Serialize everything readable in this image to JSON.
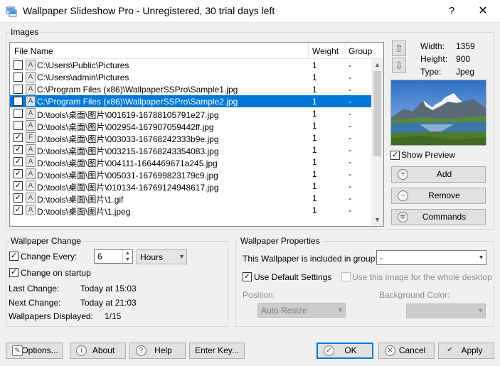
{
  "window": {
    "title": "Wallpaper Slideshow Pro - Unregistered, 30 trial days left",
    "help_glyph": "?",
    "close_glyph": "✕"
  },
  "images": {
    "group_title": "Images",
    "columns": {
      "name": "File Name",
      "weight": "Weight",
      "group": "Group"
    },
    "rows": [
      {
        "checked": false,
        "icon": "A",
        "name": "C:\\Users\\Public\\Pictures",
        "weight": "1",
        "group": "-",
        "selected": false
      },
      {
        "checked": false,
        "icon": "A",
        "name": "C:\\Users\\admin\\Pictures",
        "weight": "1",
        "group": "-",
        "selected": false
      },
      {
        "checked": false,
        "icon": "A",
        "name": "C:\\Program Files (x86)\\WallpaperSSPro\\Sample1.jpg",
        "weight": "1",
        "group": "-",
        "selected": false
      },
      {
        "checked": false,
        "icon": "A",
        "name": "C:\\Program Files (x86)\\WallpaperSSPro\\Sample2.jpg",
        "weight": "1",
        "group": "-",
        "selected": true
      },
      {
        "checked": false,
        "icon": "A",
        "name": "D:\\tools\\桌面\\图片\\001619-16788105791e27.jpg",
        "weight": "1",
        "group": "-",
        "selected": false
      },
      {
        "checked": false,
        "icon": "A",
        "name": "D:\\tools\\桌面\\图片\\002954-167907059442ff.jpg",
        "weight": "1",
        "group": "-",
        "selected": false
      },
      {
        "checked": true,
        "icon": "F",
        "name": "D:\\tools\\桌面\\图片\\003033-16768242333b9e.jpg",
        "weight": "1",
        "group": "-",
        "selected": false
      },
      {
        "checked": true,
        "icon": "A",
        "name": "D:\\tools\\桌面\\图片\\003215-16768243354083.jpg",
        "weight": "1",
        "group": "-",
        "selected": false
      },
      {
        "checked": true,
        "icon": "A",
        "name": "D:\\tools\\桌面\\图片\\004111-1664469671a245.jpg",
        "weight": "1",
        "group": "-",
        "selected": false
      },
      {
        "checked": true,
        "icon": "A",
        "name": "D:\\tools\\桌面\\图片\\005031-167699823179c9.jpg",
        "weight": "1",
        "group": "-",
        "selected": false
      },
      {
        "checked": true,
        "icon": "A",
        "name": "D:\\tools\\桌面\\图片\\010134-16769124948617.jpg",
        "weight": "1",
        "group": "-",
        "selected": false
      },
      {
        "checked": true,
        "icon": "A",
        "name": "D:\\tools\\桌面\\图片\\1.gif",
        "weight": "1",
        "group": "-",
        "selected": false
      },
      {
        "checked": true,
        "icon": "A",
        "name": "D:\\tools\\桌面\\图片\\1.jpeg",
        "weight": "1",
        "group": "-",
        "selected": false
      }
    ],
    "info": {
      "width_label": "Width:",
      "width_value": "1359",
      "height_label": "Height:",
      "height_value": "900",
      "type_label": "Type:",
      "type_value": "Jpeg"
    },
    "show_preview_label": "Show Preview",
    "show_preview_checked": true,
    "add_label": "Add",
    "remove_label": "Remove",
    "commands_label": "Commands"
  },
  "change": {
    "group_title": "Wallpaper Change",
    "change_every_label": "Change Every:",
    "change_every_checked": true,
    "interval_value": "6",
    "interval_unit": "Hours",
    "change_on_startup_label": "Change on startup",
    "change_on_startup_checked": true,
    "last_change_label": "Last Change:",
    "last_change_value": "Today at 15:03",
    "next_change_label": "Next Change:",
    "next_change_value": "Today at 21:03",
    "displayed_label": "Wallpapers Displayed:",
    "displayed_value": "1/15"
  },
  "properties": {
    "group_title": "Wallpaper Properties",
    "group_label": "This Wallpaper is included in group:",
    "group_value": "-",
    "use_default_label": "Use Default Settings",
    "use_default_checked": true,
    "whole_desktop_label": "Use this image for the whole desktop",
    "position_label": "Position:",
    "position_value": "Auto Resize",
    "bg_color_label": "Background Color:"
  },
  "footer": {
    "options_label": "Options...",
    "about_label": "About",
    "help_label": "Help",
    "enter_key_label": "Enter Key...",
    "ok_label": "OK",
    "cancel_label": "Cancel",
    "apply_label": "Apply"
  },
  "colors": {
    "selection": "#0078d7",
    "window_bg": "#f0f0f0",
    "button_bg": "#e1e1e1"
  }
}
